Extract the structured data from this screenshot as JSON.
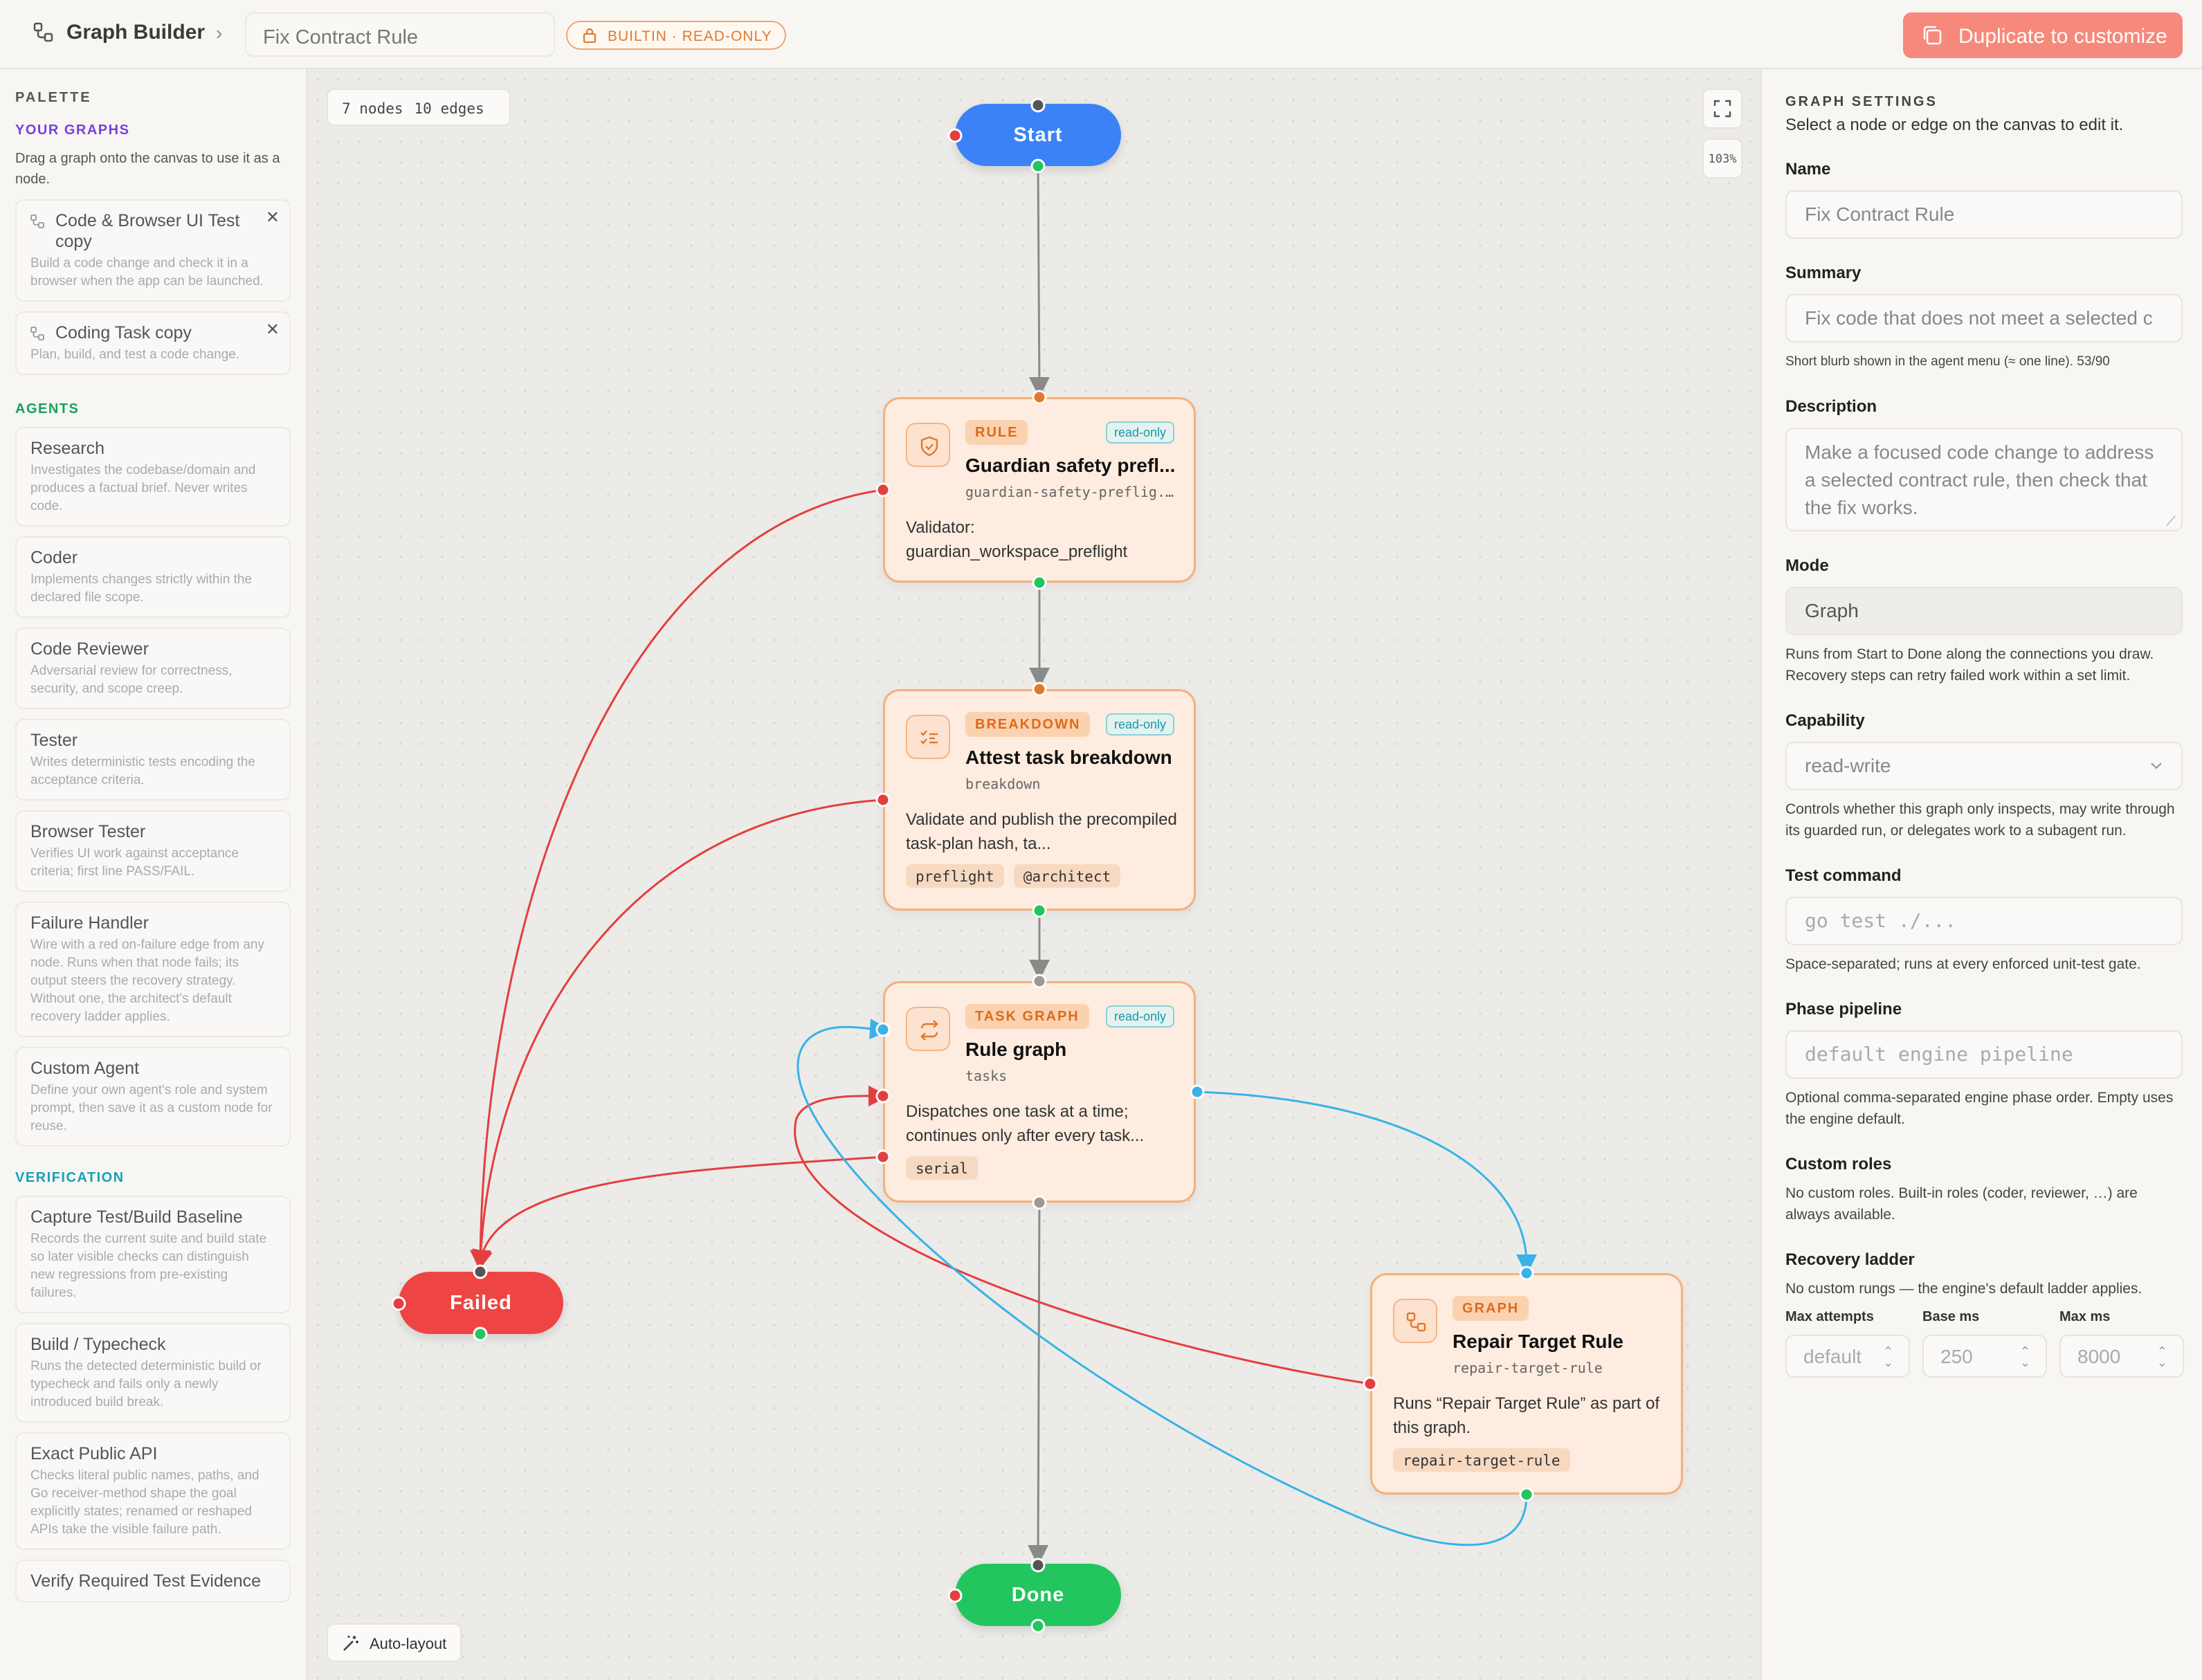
{
  "header": {
    "app_title": "Graph Builder",
    "graph_name": "Fix Contract Rule",
    "badge": "BUILTIN · READ-ONLY",
    "duplicate_label": "Duplicate to customize"
  },
  "palette": {
    "heading": "PALETTE",
    "your_graphs_heading": "YOUR GRAPHS",
    "your_graphs_hint": "Drag a graph onto the canvas to use it as a node.",
    "your_graphs": [
      {
        "title": "Code & Browser UI Test copy",
        "desc": "Build a code change and check it in a browser when the app can be launched."
      },
      {
        "title": "Coding Task copy",
        "desc": "Plan, build, and test a code change."
      }
    ],
    "agents_heading": "AGENTS",
    "agents": [
      {
        "title": "Research",
        "desc": "Investigates the codebase/domain and produces a factual brief. Never writes code."
      },
      {
        "title": "Coder",
        "desc": "Implements changes strictly within the declared file scope."
      },
      {
        "title": "Code Reviewer",
        "desc": "Adversarial review for correctness, security, and scope creep."
      },
      {
        "title": "Tester",
        "desc": "Writes deterministic tests encoding the acceptance criteria."
      },
      {
        "title": "Browser Tester",
        "desc": "Verifies UI work against acceptance criteria; first line PASS/FAIL."
      },
      {
        "title": "Failure Handler",
        "desc": "Wire with a red on-failure edge from any node. Runs when that node fails; its output steers the recovery strategy. Without one, the architect's default recovery ladder applies."
      },
      {
        "title": "Custom Agent",
        "desc": "Define your own agent's role and system prompt, then save it as a custom node for reuse."
      }
    ],
    "verification_heading": "VERIFICATION",
    "verification": [
      {
        "title": "Capture Test/Build Baseline",
        "desc": "Records the current suite and build state so later visible checks can distinguish new regressions from pre-existing failures."
      },
      {
        "title": "Build / Typecheck",
        "desc": "Runs the detected deterministic build or typecheck and fails only a newly introduced build break."
      },
      {
        "title": "Exact Public API",
        "desc": "Checks literal public names, paths, and Go receiver-method shape the goal explicitly states; renamed or reshaped APIs take the visible failure path."
      },
      {
        "title": "Verify Required Test Evidence",
        "desc": ""
      }
    ]
  },
  "canvas": {
    "stats_nodes": "7 nodes",
    "stats_edges": "10 edges",
    "zoom": "103%",
    "auto_layout": "Auto-layout",
    "start_label": "Start",
    "failed_label": "Failed",
    "done_label": "Done",
    "nodes": {
      "rule": {
        "tag": "RULE",
        "ro": "read-only",
        "title": "Guardian safety prefl...",
        "sub": "guardian-safety-preflig...",
        "body": "Validator: guardian_workspace_preflight"
      },
      "breakdown": {
        "tag": "BREAKDOWN",
        "ro": "read-only",
        "title": "Attest task breakdown",
        "sub": "breakdown",
        "body": "Validate and publish the precompiled task-plan hash, ta...",
        "chips": [
          "preflight",
          "@architect"
        ]
      },
      "taskgraph": {
        "tag": "TASK GRAPH",
        "ro": "read-only",
        "title": "Rule graph",
        "sub": "tasks",
        "body": "Dispatches one task at a time; continues only after every task...",
        "chips": [
          "serial"
        ]
      },
      "graph": {
        "tag": "GRAPH",
        "title": "Repair Target Rule",
        "sub": "repair-target-rule",
        "body": "Runs “Repair Target Rule” as part of this graph.",
        "chips": [
          "repair-target-rule"
        ]
      }
    }
  },
  "settings": {
    "heading": "GRAPH SETTINGS",
    "subheading": "Select a node or edge on the canvas to edit it.",
    "name_label": "Name",
    "name_value": "Fix Contract Rule",
    "summary_label": "Summary",
    "summary_value": "Fix code that does not meet a selected c",
    "summary_help": "Short blurb shown in the agent menu (≈ one line). 53/90",
    "description_label": "Description",
    "description_value": "Make a focused code change to address a selected contract rule, then check that the fix works.",
    "mode_label": "Mode",
    "mode_value": "Graph",
    "mode_help": "Runs from Start to Done along the connections you draw. Recovery steps can retry failed work within a set limit.",
    "capability_label": "Capability",
    "capability_value": "read-write",
    "capability_help": "Controls whether this graph only inspects, may write through its guarded run, or delegates work to a subagent run.",
    "test_label": "Test command",
    "test_placeholder": "go test ./...",
    "test_help": "Space-separated; runs at every enforced unit-test gate.",
    "phase_label": "Phase pipeline",
    "phase_placeholder": "default engine pipeline",
    "phase_help": "Optional comma-separated engine phase order. Empty uses the engine default.",
    "roles_label": "Custom roles",
    "roles_help": "No custom roles. Built-in roles (coder, reviewer, …) are always available.",
    "ladder_label": "Recovery ladder",
    "ladder_help": "No custom rungs — the engine's default ladder applies.",
    "max_attempts_label": "Max attempts",
    "max_attempts_value": "default",
    "base_ms_label": "Base ms",
    "base_ms_value": "250",
    "max_ms_label": "Max ms",
    "max_ms_value": "8000"
  },
  "colors": {
    "start": "#3b82f6",
    "failed": "#ef4444",
    "done": "#22c55e",
    "edge_default": "#8a8a8a",
    "edge_failure": "#e53e3e",
    "edge_loop": "#38b2e8",
    "accent_orange": "#e07a2e"
  }
}
